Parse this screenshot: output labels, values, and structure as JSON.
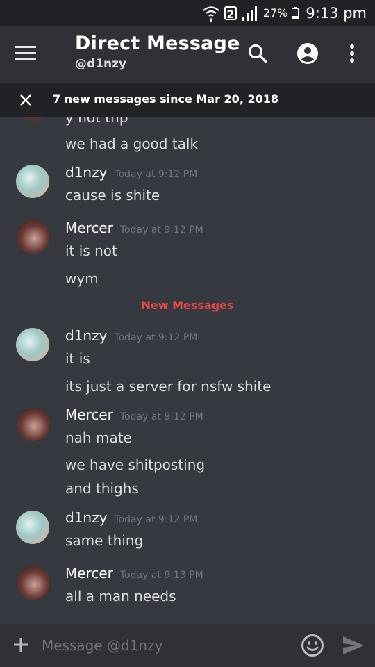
{
  "status_bar": {
    "sim": "2",
    "battery": "27%",
    "battery_level": 0.27,
    "time": "9:13 pm"
  },
  "header": {
    "title": "Direct Message",
    "subtitle": "@d1nzy"
  },
  "banner": {
    "text": "7 new messages since Mar 20, 2018"
  },
  "messages": {
    "cut_line": "y not tnp",
    "m1": {
      "text": "we had a good talk"
    },
    "g1": {
      "author": "d1nzy",
      "time": "Today at 9:12 PM",
      "lines": [
        "cause is shite"
      ]
    },
    "g2": {
      "author": "Mercer",
      "time": "Today at 9:12 PM",
      "lines": [
        "it is not",
        "wym"
      ]
    },
    "divider": "New Messages",
    "g3": {
      "author": "d1nzy",
      "time": "Today at 9:12 PM",
      "lines": [
        "it is",
        "its just a server for nsfw shite"
      ]
    },
    "g4": {
      "author": "Mercer",
      "time": "Today at 9:12 PM",
      "lines": [
        "nah mate",
        "we have shitposting",
        "and thighs"
      ]
    },
    "g5": {
      "author": "d1nzy",
      "time": "Today at 9:12 PM",
      "lines": [
        "same thing"
      ]
    },
    "g6": {
      "author": "Mercer",
      "time": "Today at 9:13 PM",
      "lines": [
        "all a man needs"
      ]
    }
  },
  "composer": {
    "placeholder": "Message @d1nzy"
  }
}
